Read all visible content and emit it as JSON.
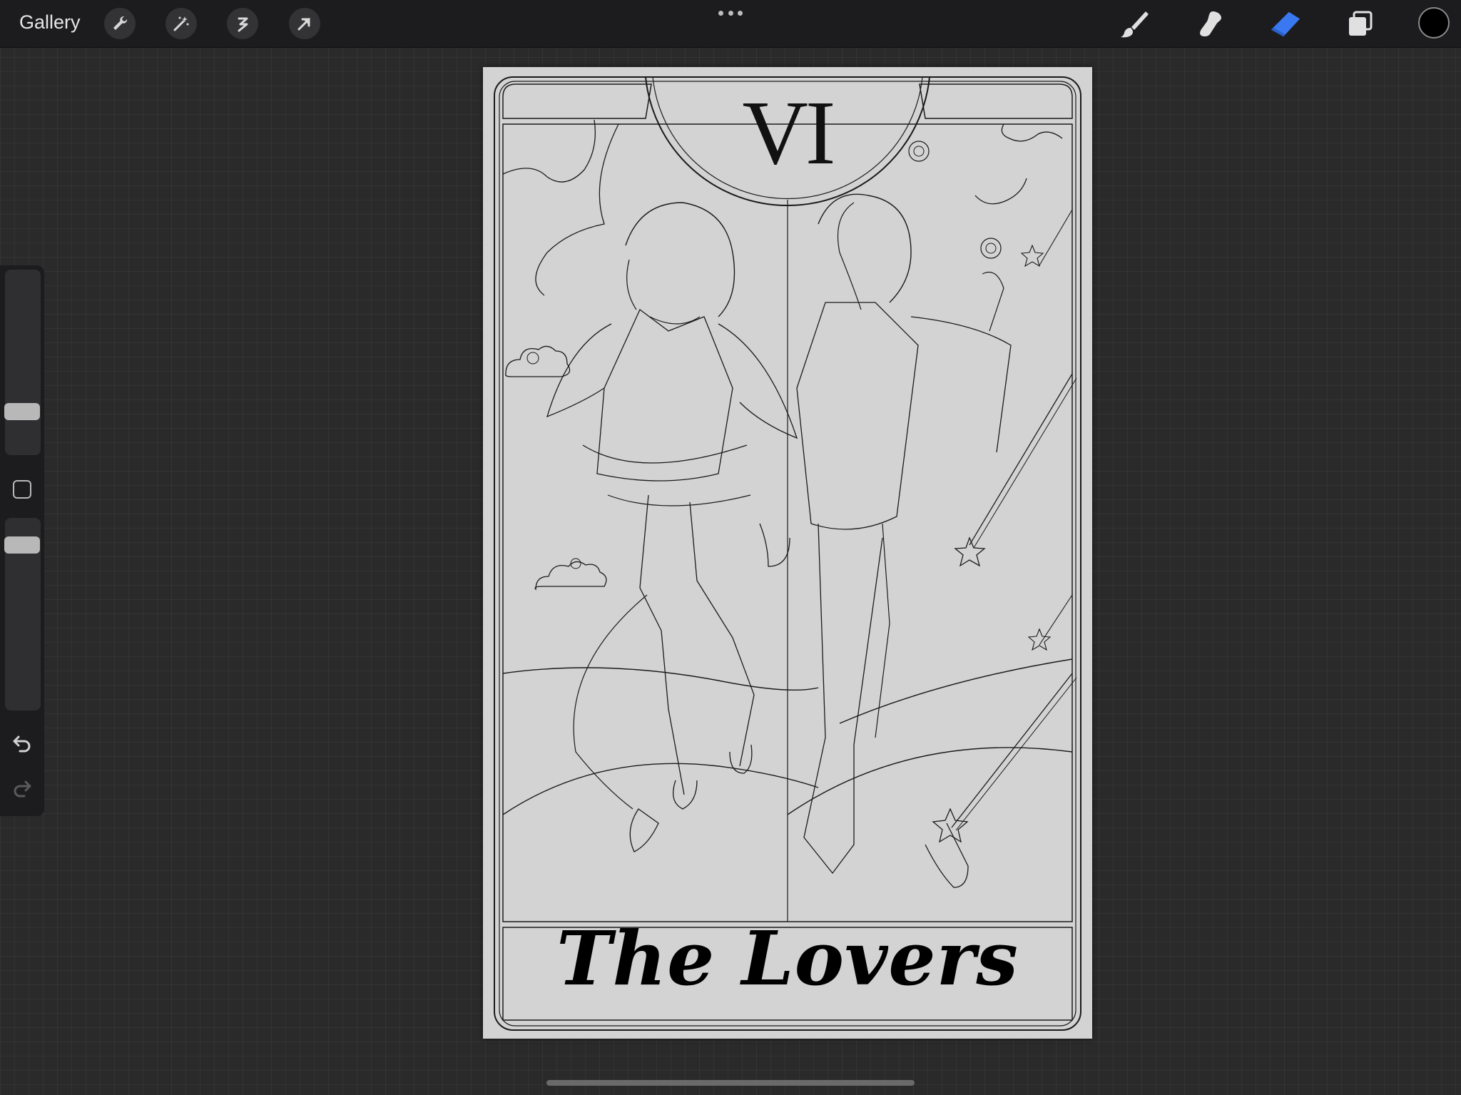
{
  "topbar": {
    "gallery_label": "Gallery",
    "left_tools": [
      "wrench-icon",
      "magic-wand-icon",
      "selection-icon",
      "transform-arrow-icon"
    ],
    "right_tools": [
      "brush-icon",
      "smudge-icon",
      "eraser-icon",
      "layers-icon"
    ],
    "active_tool": "eraser",
    "active_color": "#000000",
    "accent_color": "#3a78f2"
  },
  "sidebar": {
    "brush_size_level": 0.3,
    "opacity_level": 0.9
  },
  "canvas": {
    "card_number": "VI",
    "card_title": "The Lovers",
    "background": "#d3d3d3",
    "line_color": "#1a1a1a"
  }
}
